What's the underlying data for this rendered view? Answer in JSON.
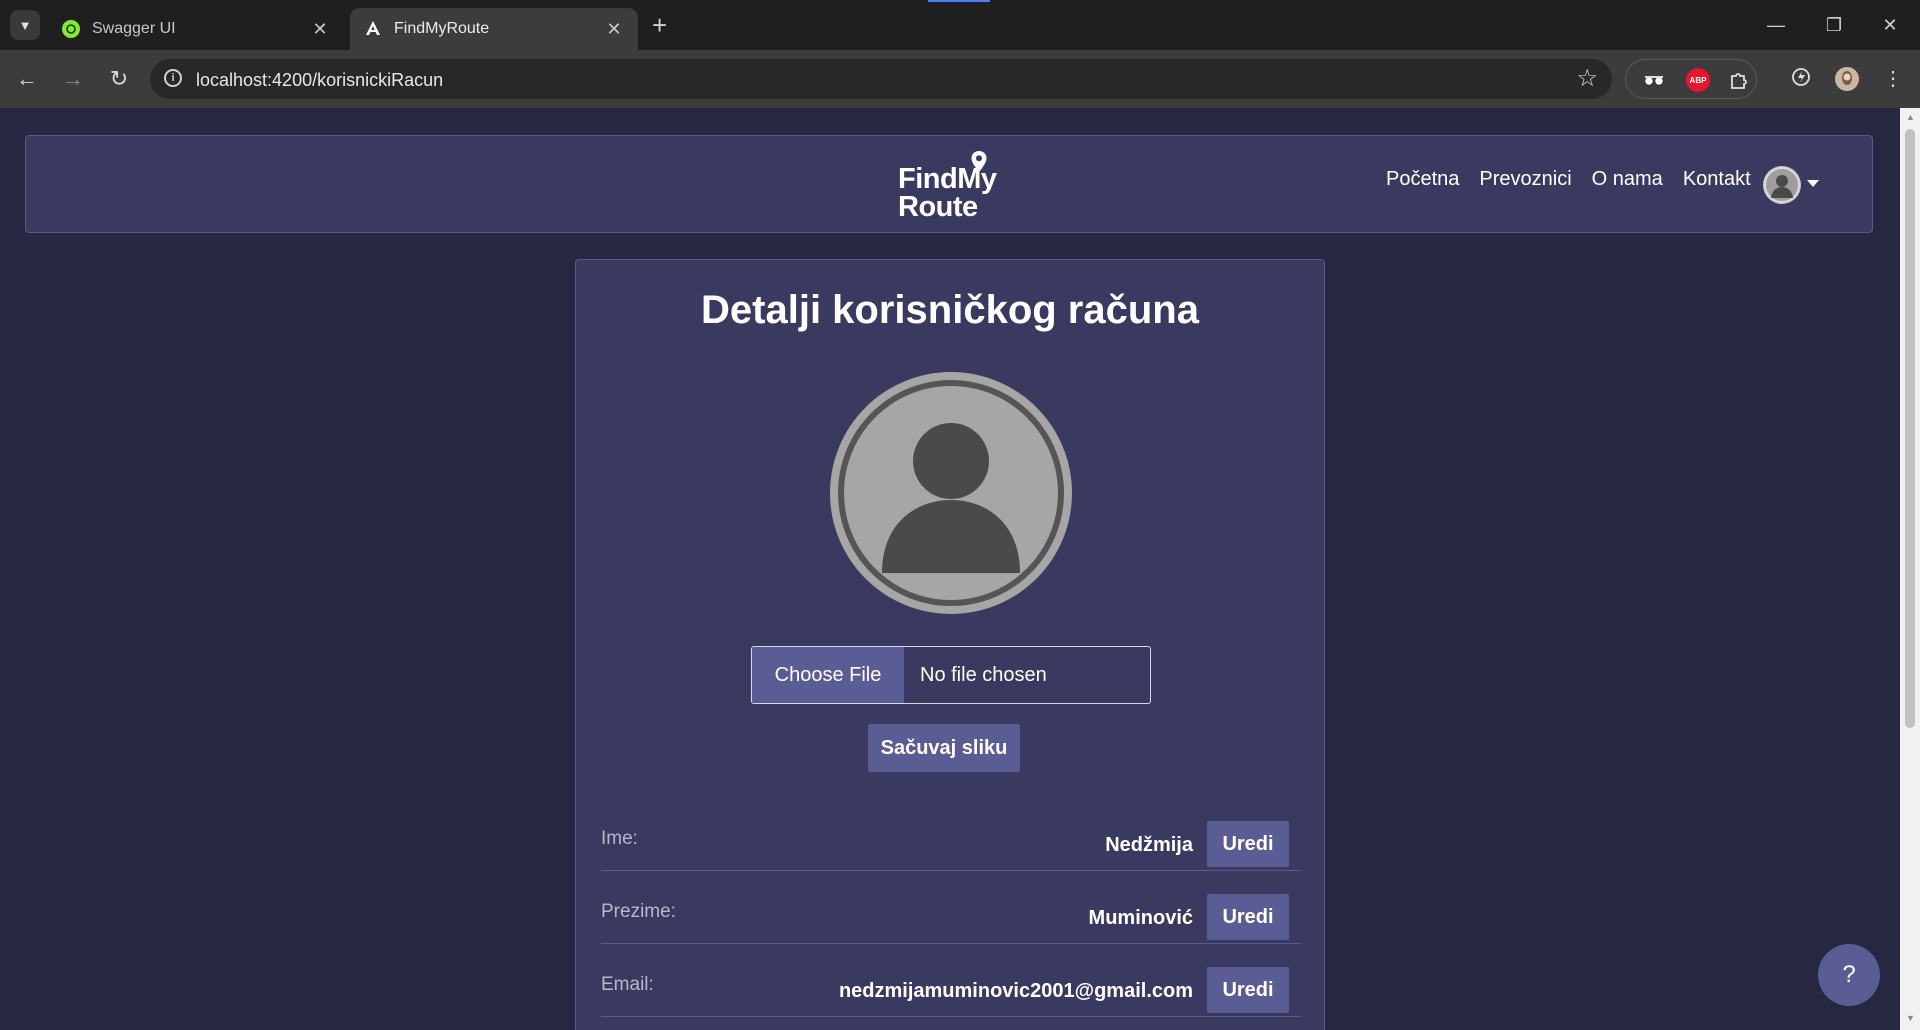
{
  "browser": {
    "tabs": [
      {
        "title": "Swagger UI",
        "active": false
      },
      {
        "title": "FindMyRoute",
        "active": true
      }
    ],
    "url": "localhost:4200/korisnickiRacun",
    "new_tab_symbol": "+",
    "extensions": [
      "spy-glasses-icon",
      "adblock-plus-icon",
      "puzzle-icon"
    ],
    "abp_label": "ABP"
  },
  "navbar": {
    "logo_line1": "FindMy",
    "logo_line2": "Route",
    "links": [
      "Početna",
      "Prevoznici",
      "O nama",
      "Kontakt"
    ]
  },
  "account": {
    "title": "Detalji korisničkog računa",
    "file_button": "Choose File",
    "file_status": "No file chosen",
    "save_image": "Sačuvaj sliku",
    "fields": [
      {
        "label": "Ime:",
        "value": "Nedžmija"
      },
      {
        "label": "Prezime:",
        "value": "Muminović"
      },
      {
        "label": "Email:",
        "value": "nedzmijamuminovic2001@gmail.com"
      }
    ],
    "edit_label": "Uredi"
  },
  "help_label": "?",
  "colors": {
    "page_bg": "#262842",
    "card_bg": "#3a3a61",
    "button": "#5c5c94"
  }
}
